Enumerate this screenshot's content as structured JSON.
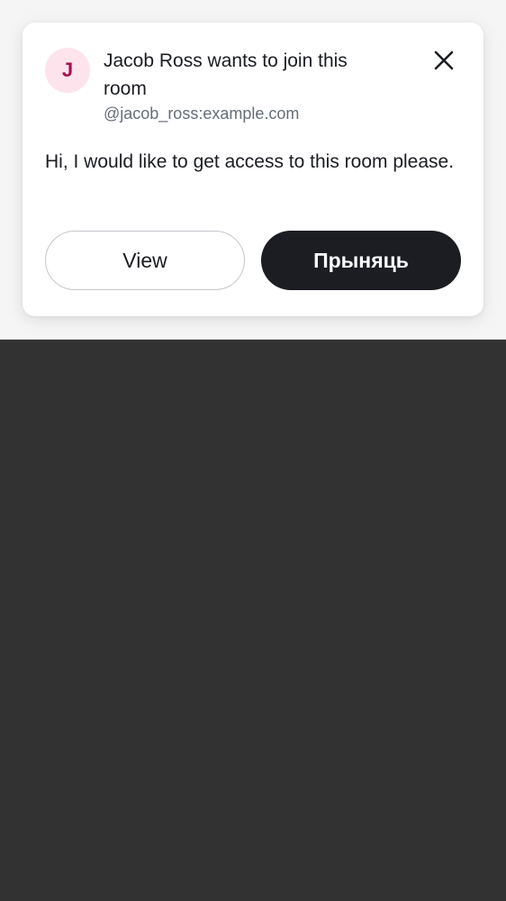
{
  "request": {
    "avatar_initial": "J",
    "title": "Jacob Ross wants to join this room",
    "user_id": "@jacob_ross:example.com",
    "message": "Hi, I would like to get access to this room please.",
    "close_icon": "close-icon"
  },
  "actions": {
    "view_label": "View",
    "accept_label": "Прыняць"
  },
  "colors": {
    "avatar_bg": "#fde3ec",
    "avatar_text": "#a3114f",
    "accept_bg": "#1b1d22",
    "page_top": "#f5f5f5",
    "page_bottom": "#323232"
  }
}
